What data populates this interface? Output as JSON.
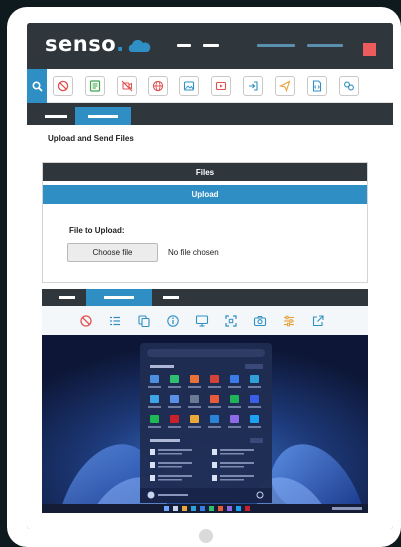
{
  "brand": {
    "name": "senso",
    "dot": "."
  },
  "toolbar": {
    "icons": [
      "block-icon",
      "checklist-icon",
      "mute-icon",
      "globe-icon",
      "screenshot-icon",
      "video-icon",
      "login-icon",
      "send-icon",
      "file-code-icon",
      "link-icon"
    ]
  },
  "panel": {
    "title": "Upload and Send Files",
    "files_header": "Files",
    "upload_header": "Upload",
    "file_label": "File to Upload:",
    "choose_button": "Choose file",
    "no_file_text": "No file chosen"
  },
  "viewer": {
    "tools": [
      "block-icon",
      "list-icon",
      "copy-icon",
      "info-icon",
      "monitor-icon",
      "expand-icon",
      "camera-icon",
      "sliders-icon",
      "share-icon"
    ]
  },
  "colors": {
    "accent": "#2f8fc4",
    "dark": "#2f373d",
    "alert": "#ec5c5c",
    "icon_red": "#e05252",
    "icon_green": "#3aa54a",
    "icon_orange": "#e8a13a",
    "icon_blue": "#2f8fc4"
  }
}
